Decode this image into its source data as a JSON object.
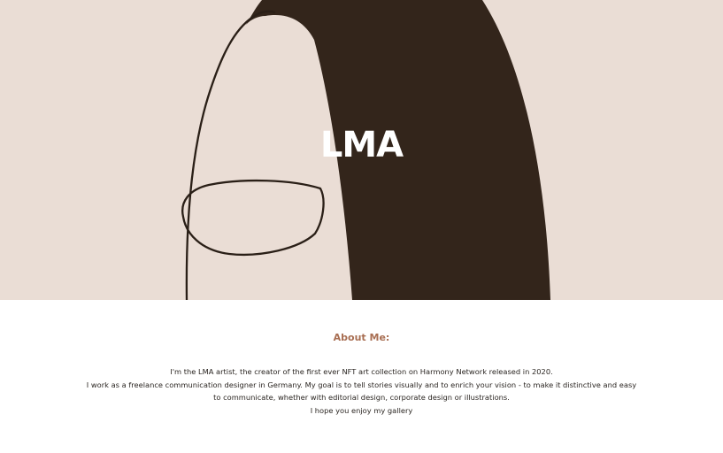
{
  "hero": {
    "title": "LMA",
    "art_name": "abstract-line-art",
    "colors": {
      "background": "#eaddd5",
      "shape": "#33251b",
      "line": "#2a1f17",
      "title": "#ffffff"
    }
  },
  "about": {
    "heading": "About Me:",
    "heading_color": "#a86e52",
    "lines": [
      "I'm the LMA artist, the creator of the first ever NFT art collection on Harmony Network released in 2020.",
      "I work as a freelance communication designer in Germany. My goal is to tell stories visually and to enrich your vision - to make it distinctive and easy",
      "to communicate, whether with editorial design, corporate design or illustrations.",
      "I hope you enjoy my gallery"
    ]
  }
}
